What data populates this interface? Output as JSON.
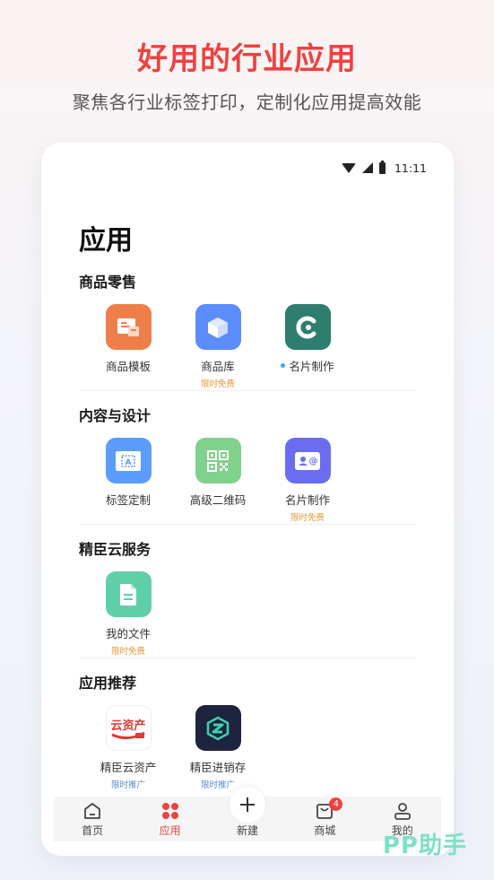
{
  "promo": {
    "title": "好用的行业应用",
    "subtitle": "聚焦各行业标签打印，定制化应用提高效能"
  },
  "statusbar": {
    "time": "11:11"
  },
  "page": {
    "title": "应用"
  },
  "sections": [
    {
      "title": "商品零售",
      "apps": [
        {
          "label": "商品模板",
          "tag": "",
          "icon": "product-template-icon",
          "color": "#ee7f4a"
        },
        {
          "label": "商品库",
          "tag": "限时免费",
          "icon": "product-library-box-icon",
          "color": "#5b8dff"
        },
        {
          "label": "名片制作",
          "tag": "",
          "icon": "business-card-c-logo-icon",
          "color": "#2e7d6f",
          "dot": true
        }
      ]
    },
    {
      "title": "内容与设计",
      "apps": [
        {
          "label": "标签定制",
          "tag": "",
          "icon": "label-custom-icon",
          "color": "#5b9cff"
        },
        {
          "label": "高级二维码",
          "tag": "",
          "icon": "qr-code-icon",
          "color": "#7fd18b"
        },
        {
          "label": "名片制作",
          "tag": "限时免费",
          "icon": "contact-card-icon",
          "color": "#6b6df0"
        }
      ]
    },
    {
      "title": "精臣云服务",
      "apps": [
        {
          "label": "我的文件",
          "tag": "限时免费",
          "icon": "document-icon",
          "color": "#5fcfa8"
        }
      ]
    },
    {
      "title": "应用推荐",
      "apps": [
        {
          "label": "精臣云资产",
          "tag": "限时推广",
          "icon": "cloud-asset-icon",
          "icon_text": "云资产",
          "color": "#ffffff"
        },
        {
          "label": "精臣进销存",
          "tag": "限时推广",
          "icon": "inventory-logo-icon",
          "color": "#1e2440"
        }
      ]
    }
  ],
  "tabbar": {
    "items": [
      {
        "label": "首页",
        "icon": "home-icon"
      },
      {
        "label": "应用",
        "icon": "apps-grid-icon",
        "active": true
      },
      {
        "label": "新建",
        "icon": "plus-icon"
      },
      {
        "label": "商城",
        "icon": "shopping-bag-icon",
        "badge": "4"
      },
      {
        "label": "我的",
        "icon": "profile-icon"
      }
    ]
  },
  "watermark": "PP助手"
}
